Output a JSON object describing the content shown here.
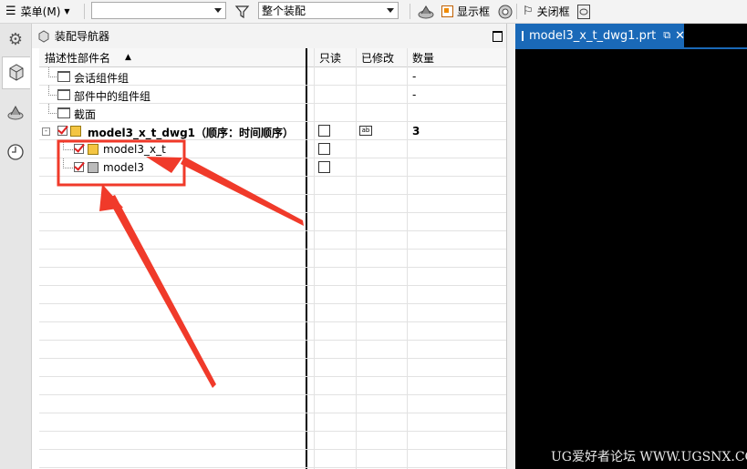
{
  "toolbar": {
    "menu_label": "菜单(M)",
    "filter_value": "整个装配",
    "show_frame_label": "显示框",
    "close_frame_label": "关闭框"
  },
  "navigator": {
    "title": "装配导航器",
    "columns": {
      "name": "描述性部件名",
      "readonly": "只读",
      "modified": "已修改",
      "quantity": "数量"
    },
    "rows": [
      {
        "name": "会话组件组",
        "quantity": "-"
      },
      {
        "name": "部件中的组件组",
        "quantity": "-"
      },
      {
        "name": "截面",
        "quantity": ""
      },
      {
        "name": "model3_x_t_dwg1（顺序：时间顺序）",
        "quantity": "3"
      },
      {
        "name": "model3_x_t",
        "quantity": ""
      },
      {
        "name": "model3",
        "quantity": ""
      }
    ]
  },
  "graphics": {
    "tab_title": "model3_x_t_dwg1.prt",
    "watermark": "UG爱好者论坛 WWW.UGSNX.COM"
  },
  "colors": {
    "accent": "#1a69b8",
    "annotation": "#f03a2a",
    "canvas": "#000000"
  }
}
